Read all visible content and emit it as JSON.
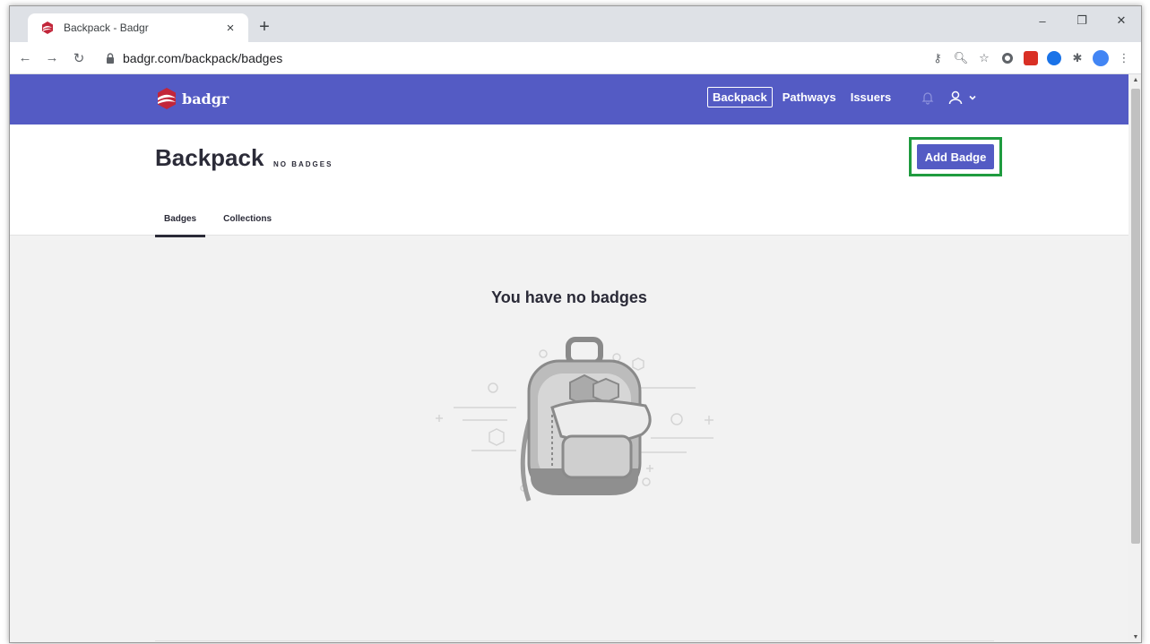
{
  "browser": {
    "tab_title": "Backpack - Badgr",
    "tab_close": "×",
    "new_tab": "+",
    "url": "badgr.com/backpack/badges",
    "window_controls": [
      "–",
      "❐",
      "✕"
    ]
  },
  "header": {
    "logo_text": "badgr",
    "nav": [
      {
        "label": "Backpack",
        "active": true
      },
      {
        "label": "Pathways",
        "active": false
      },
      {
        "label": "Issuers",
        "active": false
      }
    ]
  },
  "page": {
    "title": "Backpack",
    "count_label": "NO BADGES",
    "add_button": "Add Badge",
    "tabs": [
      {
        "label": "Badges",
        "active": true
      },
      {
        "label": "Collections",
        "active": false
      }
    ],
    "empty_message": "You have no badges"
  },
  "colors": {
    "brand": "#545bc4",
    "highlight": "#1f9b3f",
    "page_bg": "#f2f2f2",
    "text_dark": "#2b2b38"
  },
  "icons": [
    "badgr-favicon",
    "back-arrow-icon",
    "forward-arrow-icon",
    "reload-icon",
    "lock-icon",
    "key-icon",
    "zoom-icon",
    "star-icon",
    "extension-icons",
    "bell-icon",
    "user-icon",
    "chevron-down-icon",
    "backpack-illustration"
  ]
}
